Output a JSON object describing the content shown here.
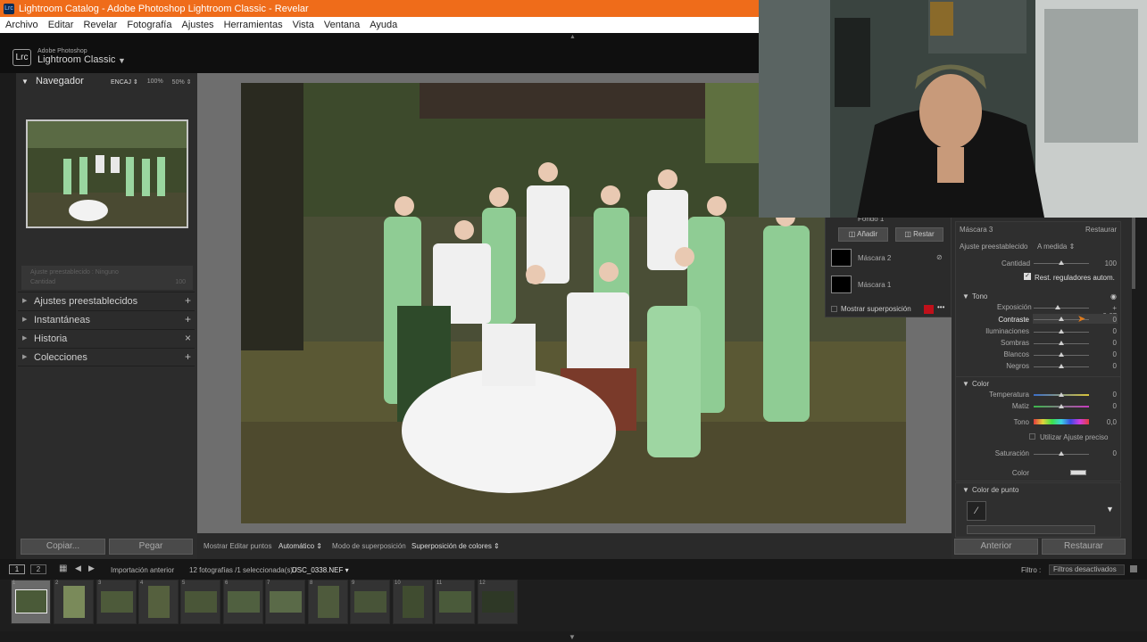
{
  "window": {
    "title": "Lightroom Catalog - Adobe Photoshop Lightroom Classic - Revelar",
    "app_icon": "Lrc"
  },
  "menu": [
    "Archivo",
    "Editar",
    "Revelar",
    "Fotografía",
    "Ajustes",
    "Herramientas",
    "Vista",
    "Ventana",
    "Ayuda"
  ],
  "identity": {
    "badge": "Lrc",
    "line1": "Adobe Photoshop",
    "line2": "Lightroom Classic"
  },
  "navigator": {
    "title": "Navegador",
    "options": [
      "ENCAJ ⇕",
      "100%",
      "50% ⇕"
    ]
  },
  "left_ghost": {
    "label": "Ajuste preestablecido : Ninguno",
    "amount_label": "Cantidad",
    "amount_value": "100"
  },
  "left_sections": [
    {
      "label": "Ajustes preestablecidos",
      "action": "+"
    },
    {
      "label": "Instantáneas",
      "action": "+"
    },
    {
      "label": "Historia",
      "action": "×"
    },
    {
      "label": "Colecciones",
      "action": "+"
    }
  ],
  "left_buttons": {
    "copy": "Copiar...",
    "paste": "Pegar"
  },
  "toolbar": {
    "edit_points": "Mostrar Editar puntos",
    "auto": "Automático ⇕",
    "overlay_mode": "Modo de superposición",
    "overlay_color": "Superposición de colores ⇕"
  },
  "mask_panel": {
    "bg_label": "Fondo 1",
    "add": "Añadir",
    "subtract": "Restar",
    "masks": [
      "Máscara 2",
      "Máscara 1"
    ],
    "show_overlay": "Mostrar superposición",
    "overlay_color": "#c0101a"
  },
  "right_panel": {
    "mask_name": "Máscara 3",
    "reset": "Restaurar",
    "preset_label": "Ajuste preestablecido",
    "preset_value": "A medida ⇕",
    "amount_label": "Cantidad",
    "amount_value": "100",
    "reset_auto_label": "Rest. reguladores autom.",
    "tone_title": "Tono",
    "tone_sliders": [
      {
        "label": "Exposición",
        "value": "+ 0,67"
      },
      {
        "label": "Contraste",
        "value": "0"
      },
      {
        "label": "Iluminaciones",
        "value": "0"
      },
      {
        "label": "Sombras",
        "value": "0"
      },
      {
        "label": "Blancos",
        "value": "0"
      },
      {
        "label": "Negros",
        "value": "0"
      }
    ],
    "color_title": "Color",
    "color_sliders": [
      {
        "label": "Temperatura",
        "value": "0"
      },
      {
        "label": "Matiz",
        "value": "0"
      },
      {
        "label": "Tono",
        "value": "0,0"
      }
    ],
    "fine_adjust_label": "Utilizar Ajuste preciso",
    "saturation": {
      "label": "Saturación",
      "value": "0"
    },
    "color_label": "Color",
    "point_color_title": "Color de punto",
    "prev_button": "Anterior",
    "restore_button": "Restaurar"
  },
  "filmstrip_bar": {
    "views": [
      "1",
      "2"
    ],
    "source": "Importación anterior",
    "count": "12 fotografías /1 seleccionada(s) /",
    "filename": "DSC_0338.NEF ▾",
    "filter_label": "Filtro :",
    "filter_value": "Filtros desactivados"
  },
  "thumbnails": [
    "1",
    "2",
    "3",
    "4",
    "5",
    "6",
    "7",
    "8",
    "9",
    "10",
    "11",
    "12"
  ],
  "colors": {
    "title_bar": "#ef6c1a",
    "panel": "#2c2c2c",
    "background": "#1b1b1b",
    "dress_green": "#8fcc94"
  }
}
